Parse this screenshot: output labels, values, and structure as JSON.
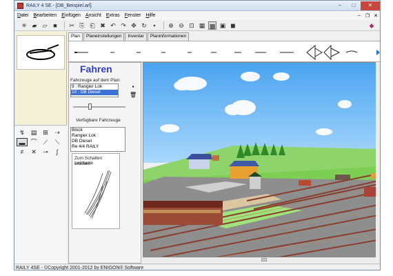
{
  "window": {
    "title": "RAILY 4 SE - [DB_Beispiel.arl]"
  },
  "menu": [
    "Datei",
    "Bearbeiten",
    "Einfügen",
    "Ansicht",
    "Extras",
    "Fenster",
    "Hilfe"
  ],
  "tabs": [
    "Plan",
    "Planeinstellungen",
    "Inventar",
    "Planinformationen"
  ],
  "panel": {
    "title": "Fahren",
    "on_plan_label": "Fahrzeuge auf dem Plan:",
    "on_plan": [
      {
        "label": "9 : Rangier Lok",
        "selected": false
      },
      {
        "label": "10 : DB Diesel",
        "selected": true
      }
    ],
    "available_label": "Verfügbare Fahrzeuge",
    "available": [
      "Block",
      "Rangier Lok",
      "DB Diesel",
      "Re 4/4 RAILY"
    ],
    "switch_hint_line1": "Zum Schalten Leertaste",
    "switch_hint_line2": "drücken"
  },
  "status": {
    "copyright": "RAILY 4SE - ©Copyright 2001-2012 by ENIGON® Software"
  },
  "colors": {
    "title_blue": "#2b3fd6",
    "left_panel": "#f3f1d6",
    "sky": "#57a9f2",
    "grass": "#78c850",
    "rail": "#8a3c2a"
  }
}
